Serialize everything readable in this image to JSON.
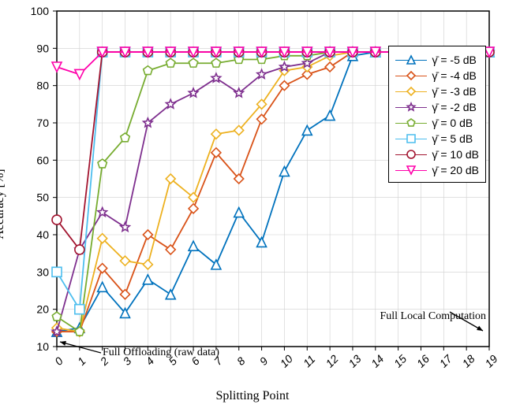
{
  "chart_data": {
    "type": "line",
    "title": "",
    "xlabel": "Splitting Point",
    "ylabel": "Accuracy [%]",
    "xlim": [
      0,
      19
    ],
    "ylim": [
      10,
      100
    ],
    "xticks": [
      0,
      1,
      2,
      3,
      4,
      5,
      6,
      7,
      8,
      9,
      10,
      11,
      12,
      13,
      14,
      15,
      16,
      17,
      18,
      19
    ],
    "yticks": [
      10,
      20,
      30,
      40,
      50,
      60,
      70,
      80,
      90,
      100
    ],
    "categories": [
      0,
      1,
      2,
      3,
      4,
      5,
      6,
      7,
      8,
      9,
      10,
      11,
      12,
      13,
      14,
      15,
      16,
      17,
      18,
      19
    ],
    "grid": true,
    "legend_position": "upper-right-inset",
    "series": [
      {
        "name": "γ̄ = -5 dB",
        "color": "#0072BD",
        "marker": "triangle",
        "values": [
          14,
          15,
          26,
          19,
          28,
          24,
          37,
          32,
          46,
          38,
          57,
          68,
          72,
          88,
          89,
          89,
          89,
          89,
          89,
          89
        ]
      },
      {
        "name": "γ̄ = -4 dB",
        "color": "#D95319",
        "marker": "diamond",
        "values": [
          14,
          14,
          31,
          24,
          40,
          36,
          47,
          62,
          55,
          71,
          80,
          83,
          85,
          89,
          89,
          89,
          89,
          89,
          89,
          89
        ]
      },
      {
        "name": "γ̄ = -3 dB",
        "color": "#EDB120",
        "marker": "diamond",
        "values": [
          15,
          14,
          39,
          33,
          32,
          55,
          50,
          67,
          68,
          75,
          84,
          85,
          88,
          89,
          89,
          89,
          89,
          89,
          89,
          89
        ]
      },
      {
        "name": "γ̄ = -2 dB",
        "color": "#7E2F8E",
        "marker": "star",
        "values": [
          14,
          36,
          46,
          42,
          70,
          75,
          78,
          82,
          78,
          83,
          85,
          86,
          89,
          89,
          89,
          89,
          89,
          89,
          89,
          89
        ]
      },
      {
        "name": "γ̄ = 0 dB",
        "color": "#77AC30",
        "marker": "pentagon",
        "values": [
          18,
          14,
          59,
          66,
          84,
          86,
          86,
          86,
          87,
          87,
          88,
          88,
          89,
          89,
          89,
          89,
          89,
          89,
          89,
          89
        ]
      },
      {
        "name": "γ̄ = 5 dB",
        "color": "#4DBEEE",
        "marker": "square",
        "values": [
          30,
          20,
          89,
          89,
          89,
          89,
          89,
          89,
          89,
          89,
          89,
          89,
          89,
          89,
          89,
          89,
          89,
          89,
          89,
          89
        ]
      },
      {
        "name": "γ̄ = 10 dB",
        "color": "#A2142F",
        "marker": "circle",
        "values": [
          44,
          36,
          89,
          89,
          89,
          89,
          89,
          89,
          89,
          89,
          89,
          89,
          89,
          89,
          89,
          89,
          89,
          89,
          89,
          89
        ]
      },
      {
        "name": "γ̄ = 20 dB",
        "color": "#FF00AA",
        "marker": "down-triangle",
        "values": [
          85,
          83,
          89,
          89,
          89,
          89,
          89,
          89,
          89,
          89,
          89,
          89,
          89,
          89,
          89,
          89,
          89,
          89,
          89,
          89
        ]
      }
    ],
    "annotations": [
      {
        "label": "Full Offloading (raw data)",
        "anchor": "bottom-left",
        "points_to_x": 0
      },
      {
        "label": "Full Local Computation",
        "anchor": "right",
        "points_to_x": 19
      }
    ]
  },
  "legend": {
    "items": [
      "γ̄ = -5 dB",
      "γ̄ = -4 dB",
      "γ̄ = -3 dB",
      "γ̄ = -2 dB",
      "γ̄ = 0 dB",
      "γ̄ = 5 dB",
      "γ̄ = 10 dB",
      "γ̄ = 20 dB"
    ]
  },
  "axis": {
    "xlabel": "Splitting Point",
    "ylabel": "Accuracy [%]"
  },
  "annotation_text": {
    "offloading": "Full Offloading (raw data)",
    "local": "Full Local Computation"
  }
}
